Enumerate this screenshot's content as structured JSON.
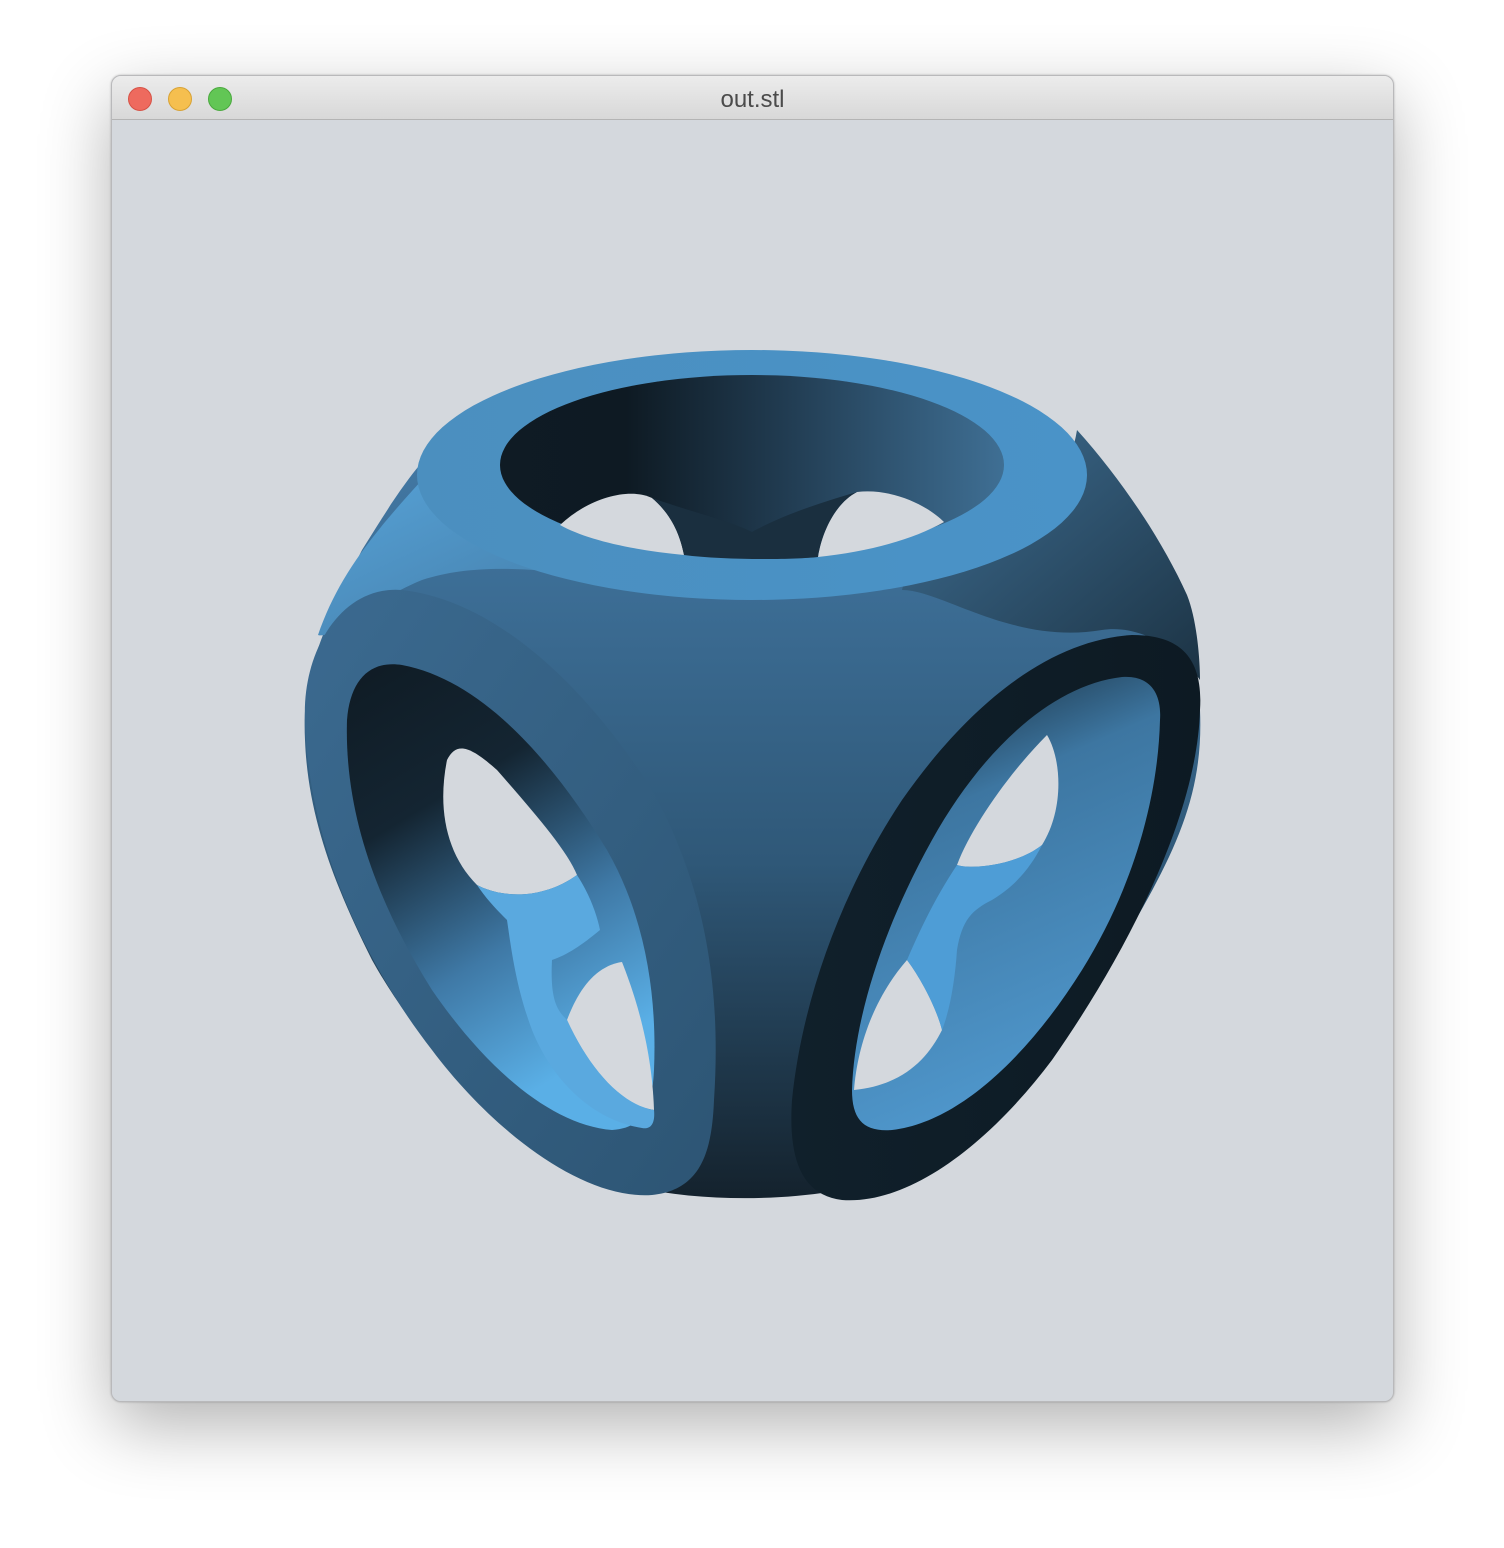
{
  "window": {
    "title": "out.stl"
  },
  "controls": {
    "close": "close-icon",
    "minimize": "minimize-icon",
    "zoom": "zoom-icon"
  },
  "viewport": {
    "background": "#d4d8dd",
    "model": {
      "description_icon": "stl-model",
      "base_color": "#4a90c4",
      "highlight_color": "#5aafe6",
      "shadow_color": "#0e1c26"
    }
  }
}
